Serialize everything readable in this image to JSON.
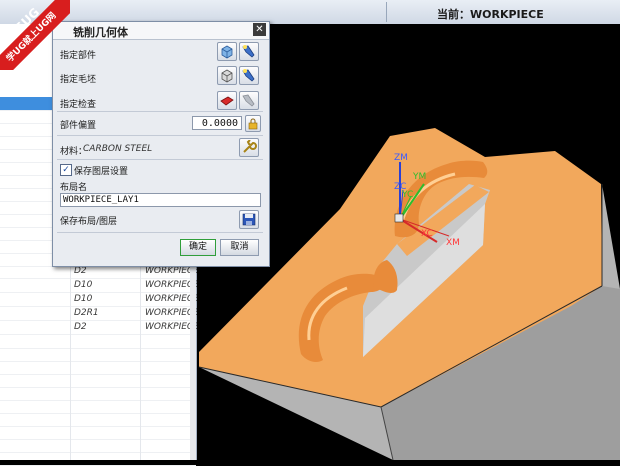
{
  "topbar": {
    "current_label": "当前：WORKPIECE"
  },
  "dialog": {
    "title": "铣削几何体",
    "close_label": "✕",
    "specify_part": "指定部件",
    "specify_blank": "指定毛坯",
    "specify_check": "指定检查",
    "part_offset_label": "部件偏置",
    "part_offset_value": "0.0000",
    "material_label": "材料：",
    "material_value": "CARBON STEEL",
    "save_layer_settings": "保存图层设置",
    "layout_name_label": "布局名",
    "layout_name_value": "WORKPIECE_LAY1",
    "save_layout_layer": "保存布局/图层",
    "ok_label": "确定",
    "cancel_label": "取消"
  },
  "navigator": {
    "rows": [
      {
        "tool": "D2",
        "geometry": "WORKPIECE"
      },
      {
        "tool": "D10",
        "geometry": "WORKPIECE"
      },
      {
        "tool": "D10",
        "geometry": "WORKPIECE"
      },
      {
        "tool": "D2R1",
        "geometry": "WORKPIECE"
      },
      {
        "tool": "D2",
        "geometry": "WORKPIECE"
      }
    ]
  },
  "triad": {
    "zm": "ZM",
    "ym": "YM",
    "zc": "ZC",
    "yc": "YC",
    "xc": "XC",
    "xm": "XM"
  },
  "watermark": {
    "line1": "9SUG",
    "line2": "学UG就上UG网"
  },
  "colors": {
    "part_face": "#f2a85c",
    "part_side": "#b9b9b9",
    "selection": "#3e8ede"
  }
}
